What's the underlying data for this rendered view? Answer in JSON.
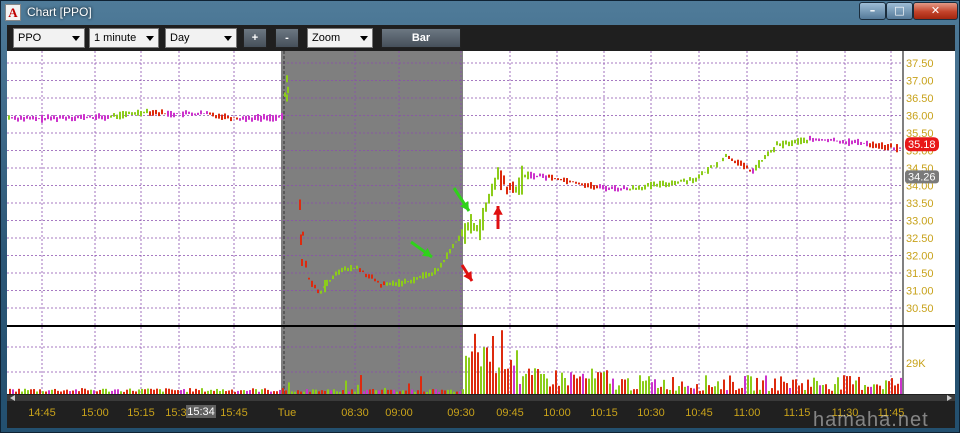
{
  "window": {
    "title": "Chart [PPO]",
    "icon": "A",
    "min": "–",
    "max": "□",
    "close": "✕"
  },
  "toolbar": {
    "symbol": "PPO",
    "interval": "1 minute",
    "period": "Day",
    "plus": "+",
    "minus": "-",
    "zoom": "Zoom",
    "bar": "Bar"
  },
  "price_axis": [
    "37.50",
    "37.00",
    "36.50",
    "36.00",
    "35.50",
    "35.00",
    "34.50",
    "34.00",
    "33.50",
    "33.00",
    "32.50",
    "32.00",
    "31.50",
    "31.00",
    "30.50"
  ],
  "last_price": "35.18",
  "prev_price": "34.26",
  "volume_label": "29K",
  "time_axis": [
    "14:45",
    "15:00",
    "15:15",
    "15:30",
    "15:34",
    "15:45",
    "Tue",
    "08:30",
    "09:00",
    "09:30",
    "09:45",
    "10:00",
    "10:15",
    "10:30",
    "10:45",
    "11:00",
    "11:15",
    "11:30",
    "11:45"
  ],
  "watermark": "hamaha.net",
  "colors": {
    "up": "#8ccc1a",
    "down": "#dd2a0e",
    "neutral": "#cc33cc",
    "premarket": "#7f7f7f",
    "grid": "#8a4fae",
    "axis_text": "#c8a21a"
  },
  "chart_data": {
    "type": "line",
    "symbol": "PPO",
    "interval": "1 minute",
    "ylim": [
      30.25,
      37.75
    ],
    "x": [
      "14:45",
      "15:00",
      "15:15",
      "15:30",
      "15:45",
      "Tue",
      "08:30",
      "09:00",
      "09:30",
      "09:45",
      "10:00",
      "10:15",
      "10:30",
      "10:45",
      "11:00",
      "11:15",
      "11:30",
      "11:45"
    ],
    "series": [
      {
        "values": [
          35.9,
          35.9,
          36.05,
          36.05,
          35.95,
          35.95,
          31.6,
          31.3,
          32.7,
          34.3,
          34.25,
          34.0,
          33.95,
          34.2,
          34.85,
          35.3,
          35.3,
          35.1
        ]
      }
    ],
    "volume_peak_label": "29K"
  }
}
